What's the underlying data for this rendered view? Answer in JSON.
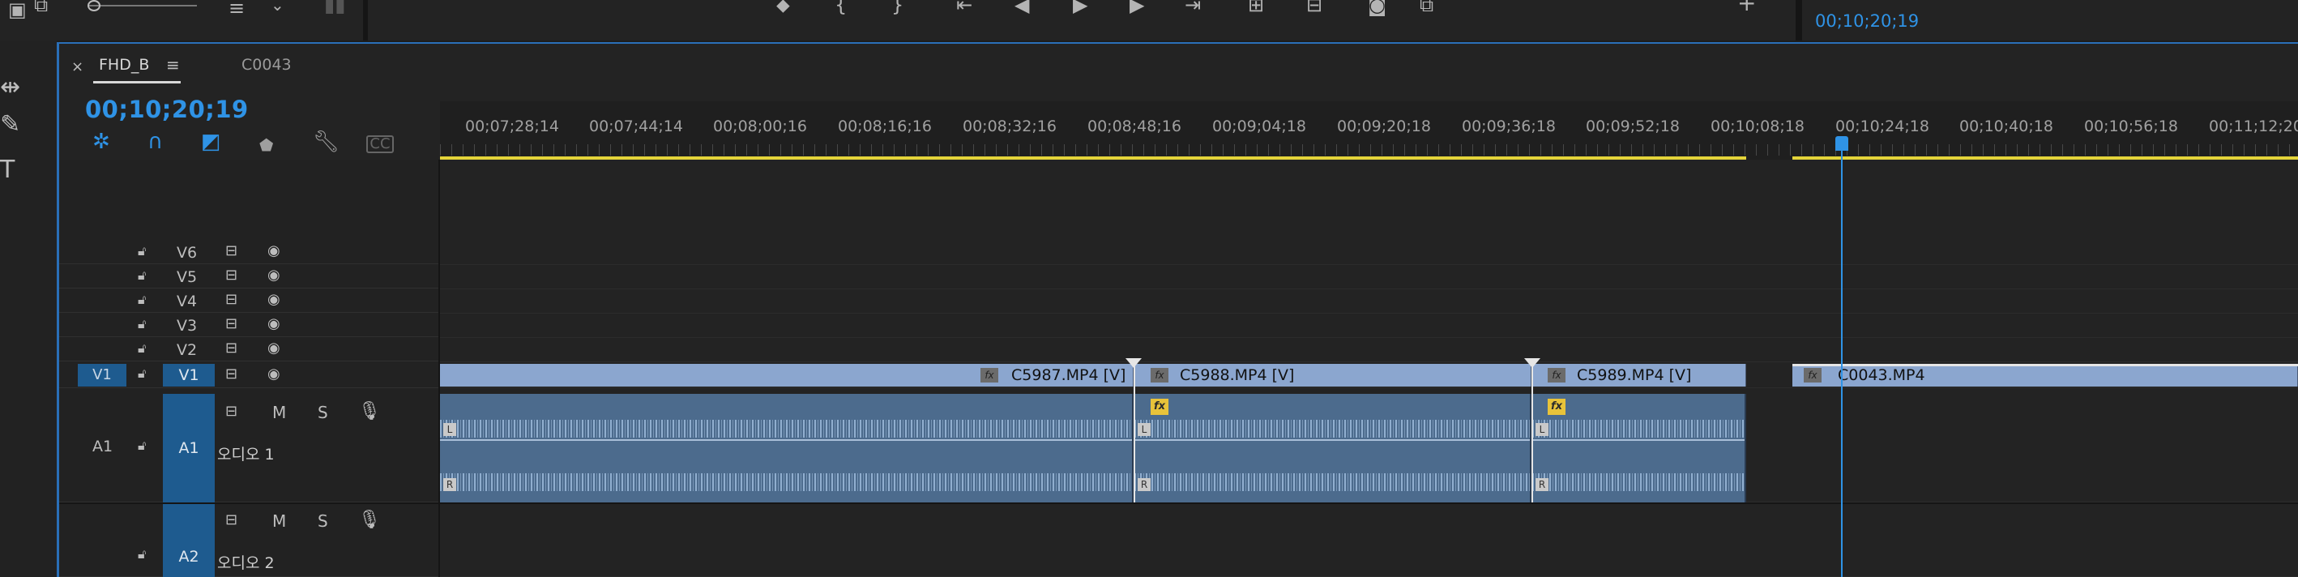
{
  "top_bar": {
    "icons": [
      "panel-icon",
      "zoom-slider-icon",
      "menu-lines-icon",
      "chevron-down-icon",
      "marker-icon",
      "mark-in-icon",
      "mark-out-icon",
      "go-to-in-icon",
      "step-back-icon",
      "play-icon",
      "step-forward-icon",
      "go-to-out-icon",
      "lift-icon",
      "extract-icon",
      "camera-icon",
      "export-frame-icon",
      "add-button-icon"
    ],
    "source_timecode": "00;10;20;19"
  },
  "tools": [
    "ripple-edit-icon",
    "pen-icon",
    "type-icon"
  ],
  "timeline": {
    "tab_close": "×",
    "sequence_tab": "FHD_B",
    "tab_menu": "≡",
    "other_tab": "C0043",
    "timecode": "00;10;20;19",
    "ruler_labels": [
      "00;07;28;14",
      "00;07;44;14",
      "00;08;00;16",
      "00;08;16;16",
      "00;08;32;16",
      "00;08;48;16",
      "00;09;04;18",
      "00;09;20;18",
      "00;09;36;18",
      "00;09;52;18",
      "00;10;08;18",
      "00;10;24;18",
      "00;10;40;18",
      "00;10;56;18",
      "00;11;12;20"
    ],
    "video_tracks": [
      {
        "name": "V6"
      },
      {
        "name": "V5"
      },
      {
        "name": "V4"
      },
      {
        "name": "V3"
      },
      {
        "name": "V2"
      },
      {
        "name": "V1",
        "source_patch": "V1"
      }
    ],
    "audio_tracks": [
      {
        "name": "A1",
        "source_patch": "A1",
        "label": "오디오 1",
        "mute": "M",
        "solo": "S"
      },
      {
        "name": "A2",
        "label": "오디오 2",
        "mute": "M",
        "solo": "S"
      }
    ],
    "video_clips": [
      "C5987.MP4 [V]",
      "C5988.MP4 [V]",
      "C5989.MP4 [V]",
      "C0043.MP4"
    ],
    "fx_label": "fx",
    "channel_left": "L",
    "channel_right": "R",
    "colors": {
      "accent": "#2f93e6",
      "video_clip": "#8ba6cf",
      "audio_clip": "#4c6b8d",
      "work_area": "#e4d43a",
      "fx_badge": "#e8c33a"
    }
  }
}
